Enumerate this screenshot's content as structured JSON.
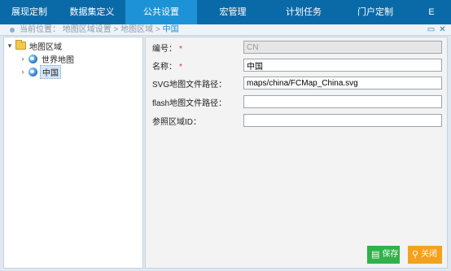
{
  "nav": {
    "tabs": [
      {
        "label": "展现定制",
        "active": false
      },
      {
        "label": "数据集定义",
        "active": false
      },
      {
        "label": "公共设置",
        "active": true
      },
      {
        "label": "宏管理",
        "active": false
      },
      {
        "label": "计划任务",
        "active": false
      },
      {
        "label": "门户定制",
        "active": false
      },
      {
        "label": "E",
        "active": false
      }
    ]
  },
  "breadcrumb": {
    "prefix": "当前位置：",
    "path": "地图区域设置 > 地图区域 >",
    "current": "中国",
    "restore_icon": "restore-icon",
    "close_icon": "close-icon"
  },
  "tree": {
    "root": {
      "label": "地图区域",
      "icon": "folder-icon",
      "expanded": true
    },
    "children": [
      {
        "label": "世界地图",
        "icon": "globe-icon",
        "expanded": false
      },
      {
        "label": "中国",
        "icon": "globe-icon",
        "expanded": false,
        "selected": true
      }
    ]
  },
  "form": {
    "fields": [
      {
        "label": "编号：",
        "required": true,
        "value": "CN",
        "disabled": true
      },
      {
        "label": "名称：",
        "required": true,
        "value": "中国",
        "disabled": false
      },
      {
        "label": "SVG地图文件路径：",
        "required": false,
        "value": "maps/china/FCMap_China.svg",
        "disabled": false
      },
      {
        "label": "flash地图文件路径：",
        "required": false,
        "value": "",
        "disabled": false
      },
      {
        "label": "参照区域ID：",
        "required": false,
        "value": "",
        "disabled": false
      }
    ],
    "required_mark": "*"
  },
  "buttons": {
    "save_label": "保存",
    "close_label": "关闭",
    "save_icon": "save-icon",
    "close_icon": "search-icon"
  },
  "colors": {
    "nav_bg": "#0a6aa8",
    "nav_active": "#1e92d6",
    "save_bg": "#2fb24a",
    "close_bg": "#f4a11c",
    "required": "#e03030"
  }
}
